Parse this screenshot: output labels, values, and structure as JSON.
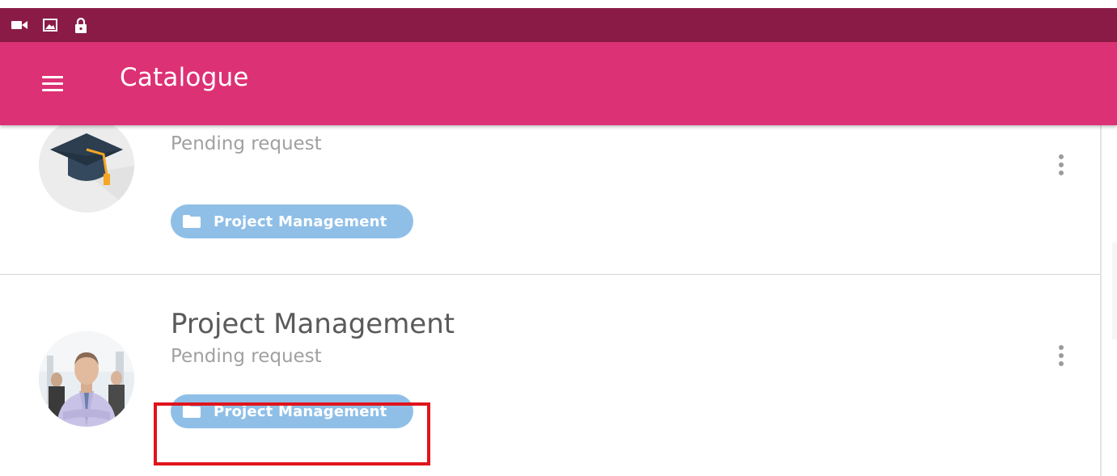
{
  "status_bar": {
    "icons": [
      "video-camera-icon",
      "image-icon",
      "lock-icon"
    ]
  },
  "app_bar": {
    "title": "Catalogue",
    "menu_icon": "hamburger-menu-icon"
  },
  "courses": [
    {
      "title": "",
      "status": "Pending request",
      "category": "Project Management",
      "avatar": "graduation-cap-icon"
    },
    {
      "title": "Project Management",
      "status": "Pending request",
      "category": "Project Management",
      "avatar": "businessman-photo"
    }
  ],
  "colors": {
    "status_bar": "#8a1b47",
    "app_bar": "#dd3175",
    "chip": "#8fbfe7",
    "highlight": "#e0141c"
  }
}
